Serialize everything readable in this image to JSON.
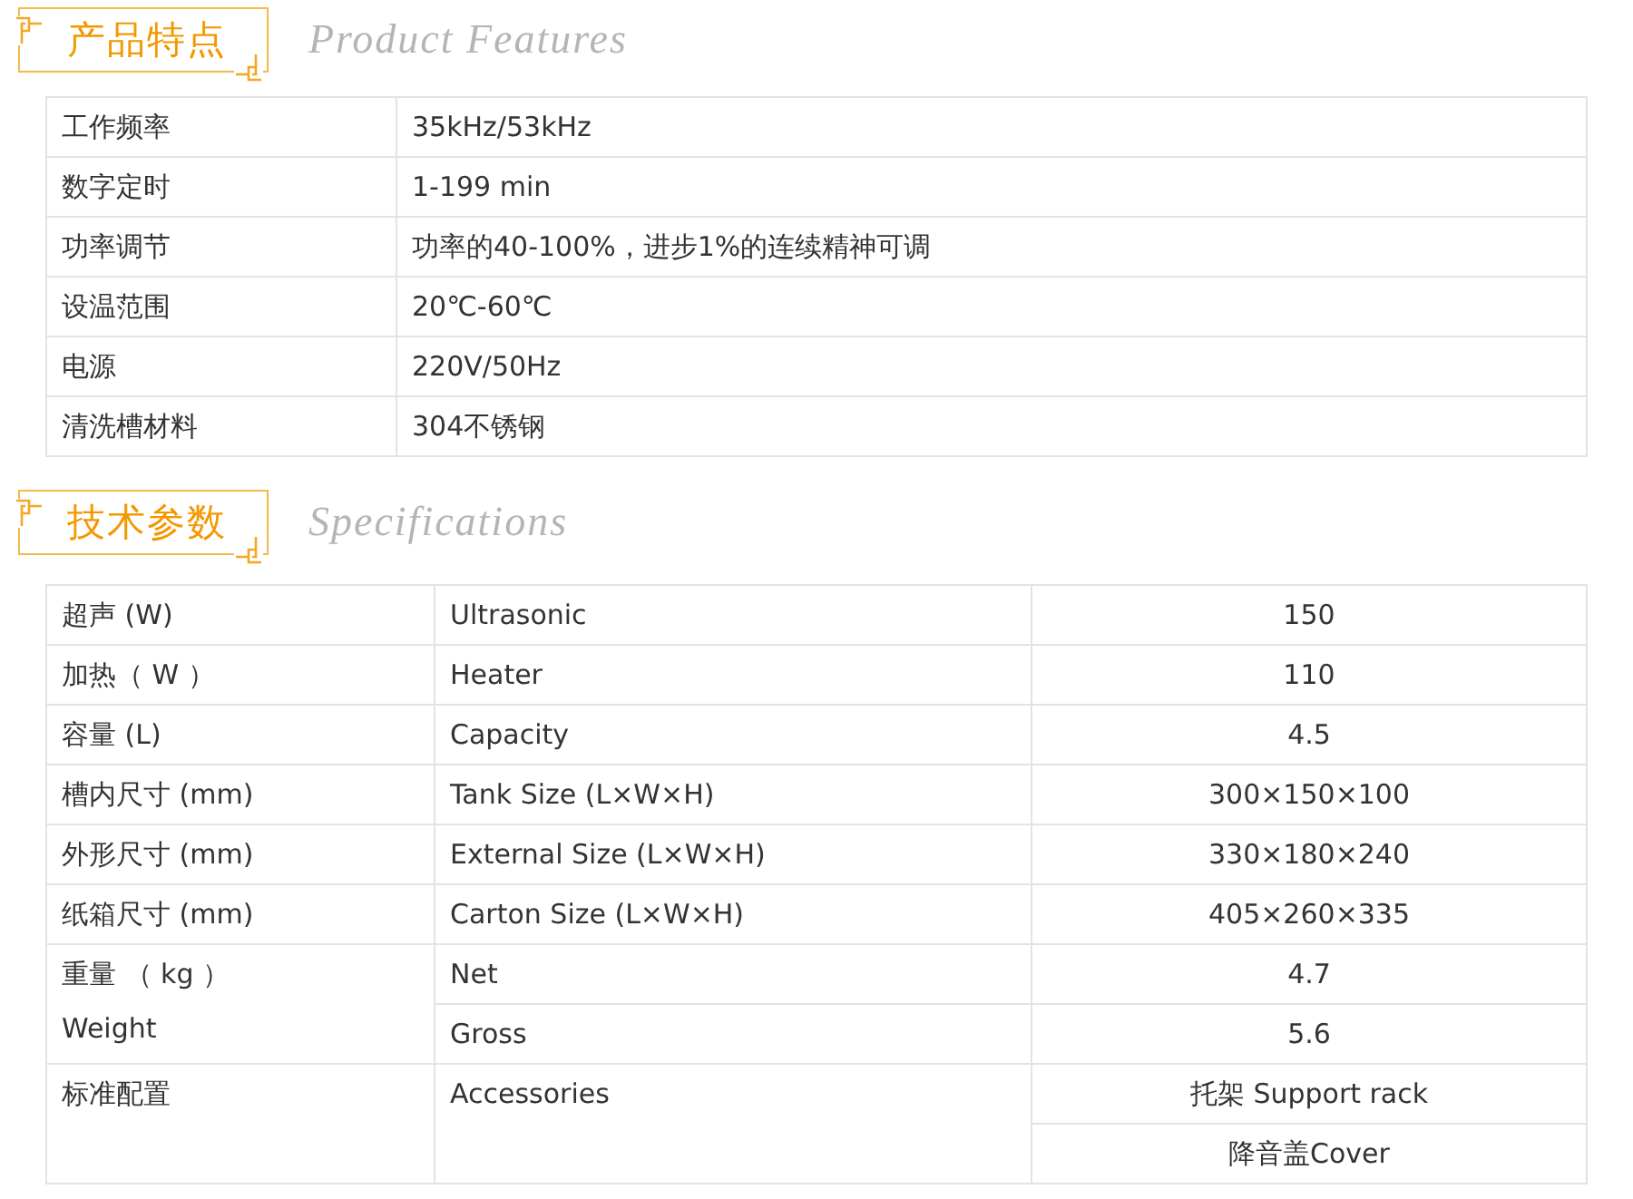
{
  "features": {
    "title": "产品特点",
    "subtitle": "Product Features",
    "rows": [
      {
        "label": "工作频率",
        "value": "35kHz/53kHz"
      },
      {
        "label": "数字定时",
        "value": "1-199 min"
      },
      {
        "label": "功率调节",
        "value": "功率的40-100%，进步1%的连续精神可调"
      },
      {
        "label": "设温范围",
        "value": "20℃-60℃"
      },
      {
        "label": "电源",
        "value": "220V/50Hz"
      },
      {
        "label": "清洗槽材料",
        "value": "304不锈钢"
      }
    ]
  },
  "specifications": {
    "title": "技术参数",
    "subtitle": "Specifications",
    "groups": [
      {
        "labels": [
          "超声 (W)"
        ],
        "rows": [
          {
            "name": "Ultrasonic",
            "value": "150"
          }
        ]
      },
      {
        "labels": [
          "加热（ W ）"
        ],
        "rows": [
          {
            "name": "Heater",
            "value": "110"
          }
        ]
      },
      {
        "labels": [
          "容量 (L)"
        ],
        "rows": [
          {
            "name": "Capacity",
            "value": "4.5"
          }
        ]
      },
      {
        "labels": [
          "槽内尺寸 (mm)"
        ],
        "rows": [
          {
            "name": "Tank Size (L×W×H)",
            "value": "300×150×100"
          }
        ]
      },
      {
        "labels": [
          "外形尺寸 (mm)"
        ],
        "rows": [
          {
            "name": "External Size (L×W×H)",
            "value": "330×180×240"
          }
        ]
      },
      {
        "labels": [
          "纸箱尺寸 (mm)"
        ],
        "rows": [
          {
            "name": "Carton Size (L×W×H)",
            "value": "405×260×335"
          }
        ]
      },
      {
        "labels": [
          "重量 （ kg ）",
          "Weight"
        ],
        "rows": [
          {
            "name": "Net",
            "value": "4.7"
          },
          {
            "name": "Gross",
            "value": "5.6"
          }
        ]
      },
      {
        "labels": [
          "标准配置"
        ],
        "rows": [
          {
            "name": "Accessories",
            "value": "托架 Support rack"
          },
          {
            "value": "降音盖Cover"
          }
        ]
      }
    ]
  }
}
